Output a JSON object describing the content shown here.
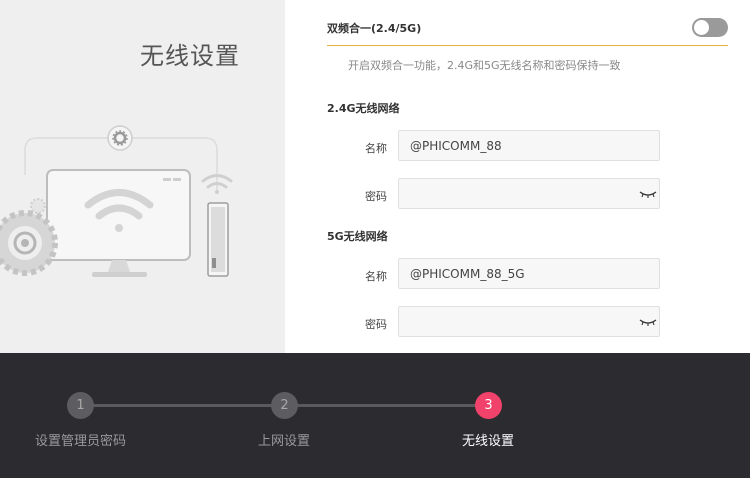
{
  "left_panel": {
    "title": "无线设置"
  },
  "dual_band": {
    "label": "双频合一(2.4/5G)",
    "enabled": false,
    "hint": "开启双频合一功能，2.4G和5G无线名称和密码保持一致"
  },
  "band_24g": {
    "heading": "2.4G无线网络",
    "name_label": "名称",
    "name_value": "@PHICOMM_88",
    "password_label": "密码",
    "password_value": ""
  },
  "band_5g": {
    "heading": "5G无线网络",
    "name_label": "名称",
    "name_value": "@PHICOMM_88_5G",
    "password_label": "密码",
    "password_value": ""
  },
  "steps": [
    {
      "number": "1",
      "label": "设置管理员密码",
      "active": false
    },
    {
      "number": "2",
      "label": "上网设置",
      "active": false
    },
    {
      "number": "3",
      "label": "无线设置",
      "active": true
    }
  ],
  "colors": {
    "accent": "#f0426a",
    "divider": "#e0b040",
    "footer_bg": "#2b2b30",
    "left_bg": "#efefef"
  }
}
